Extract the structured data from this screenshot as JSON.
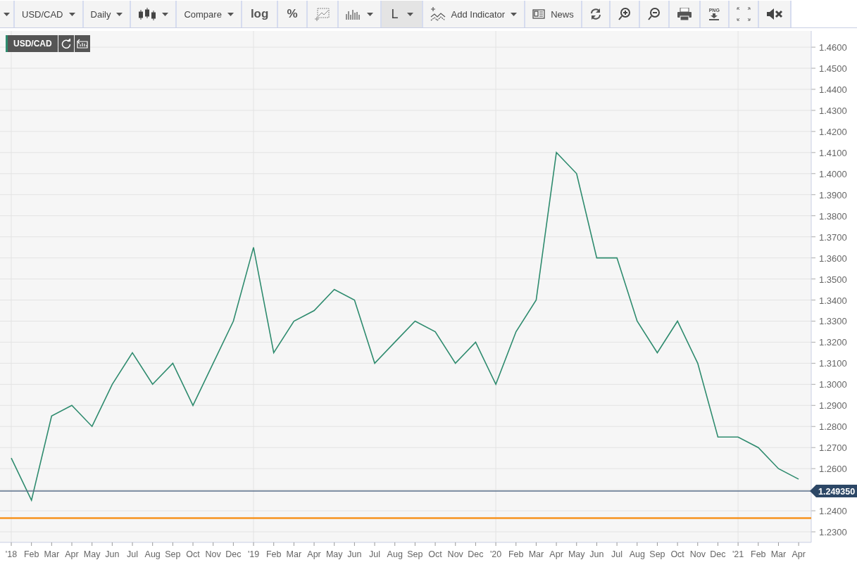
{
  "toolbar": [
    {
      "kind": "caret",
      "selected": false
    },
    {
      "kind": "dropdown",
      "label": "USD/CAD",
      "selected": false
    },
    {
      "kind": "dropdown",
      "label": "Daily",
      "selected": false
    },
    {
      "kind": "candles",
      "selected": false
    },
    {
      "kind": "dropdown",
      "label": "Compare",
      "selected": false
    },
    {
      "kind": "text",
      "label": "log",
      "selected": false
    },
    {
      "kind": "text",
      "label": "%",
      "selected": false
    },
    {
      "kind": "draw",
      "selected": false
    },
    {
      "kind": "volume",
      "selected": false
    },
    {
      "kind": "dropdown",
      "label": "L",
      "selected": true
    },
    {
      "kind": "indicator",
      "label": "Add Indicator",
      "selected": false
    },
    {
      "kind": "news",
      "label": "News",
      "selected": false
    },
    {
      "kind": "refresh",
      "selected": false
    },
    {
      "kind": "zoom-in",
      "selected": false
    },
    {
      "kind": "zoom-out",
      "selected": false
    },
    {
      "kind": "print",
      "selected": false
    },
    {
      "kind": "png",
      "label": "PNG",
      "selected": false
    },
    {
      "kind": "fullscreen",
      "selected": false
    },
    {
      "kind": "mute",
      "selected": false
    }
  ],
  "chart": {
    "chart_data": {
      "type": "line",
      "categories": [
        "'18",
        "Feb",
        "Mar",
        "Apr",
        "May",
        "Jun",
        "Jul",
        "Aug",
        "Sep",
        "Oct",
        "Nov",
        "Dec",
        "'19",
        "Feb",
        "Mar",
        "Apr",
        "May",
        "Jun",
        "Jul",
        "Aug",
        "Sep",
        "Oct",
        "Nov",
        "Dec",
        "'20",
        "Feb",
        "Mar",
        "Apr",
        "May",
        "Jun",
        "Jul",
        "Aug",
        "Sep",
        "Oct",
        "Nov",
        "Dec",
        "'21",
        "Feb",
        "Mar",
        "Apr"
      ],
      "series": [
        {
          "name": "USD/CAD",
          "color": "#2e8b6e",
          "values": [
            1.265,
            1.245,
            1.285,
            1.29,
            1.28,
            1.3,
            1.315,
            1.3,
            1.31,
            1.29,
            1.31,
            1.33,
            1.365,
            1.315,
            1.33,
            1.335,
            1.345,
            1.34,
            1.31,
            1.32,
            1.33,
            1.325,
            1.31,
            1.32,
            1.3,
            1.325,
            1.34,
            1.41,
            1.4,
            1.36,
            1.36,
            1.33,
            1.315,
            1.33,
            1.31,
            1.275,
            1.275,
            1.27,
            1.26,
            1.255
          ]
        }
      ],
      "ylim": [
        1.225,
        1.4677
      ],
      "grid": true,
      "yticks": [
        {
          "value": 1.23,
          "label": "1.2300"
        },
        {
          "value": 1.24,
          "label": "1.2400"
        },
        {
          "value": 1.26,
          "label": "1.2600"
        },
        {
          "value": 1.27,
          "label": "1.2700"
        },
        {
          "value": 1.28,
          "label": "1.2800"
        },
        {
          "value": 1.29,
          "label": "1.2900"
        },
        {
          "value": 1.3,
          "label": "1.3000"
        },
        {
          "value": 1.31,
          "label": "1.3100"
        },
        {
          "value": 1.32,
          "label": "1.3200"
        },
        {
          "value": 1.33,
          "label": "1.3300"
        },
        {
          "value": 1.34,
          "label": "1.3400"
        },
        {
          "value": 1.35,
          "label": "1.3500"
        },
        {
          "value": 1.36,
          "label": "1.3600"
        },
        {
          "value": 1.37,
          "label": "1.3700"
        },
        {
          "value": 1.38,
          "label": "1.3800"
        },
        {
          "value": 1.39,
          "label": "1.3900"
        },
        {
          "value": 1.4,
          "label": "1.4000"
        },
        {
          "value": 1.41,
          "label": "1.4100"
        },
        {
          "value": 1.42,
          "label": "1.4200"
        },
        {
          "value": 1.43,
          "label": "1.4300"
        },
        {
          "value": 1.44,
          "label": "1.4400"
        },
        {
          "value": 1.45,
          "label": "1.4500"
        },
        {
          "value": 1.46,
          "label": "1.4600"
        }
      ],
      "ref_lines": [
        {
          "axis": "y",
          "value": 1.24935,
          "label": "1.249350",
          "color": "#5a6f8a"
        },
        {
          "axis": "y",
          "value": 1.2365,
          "color": "#f7931e"
        }
      ]
    }
  }
}
